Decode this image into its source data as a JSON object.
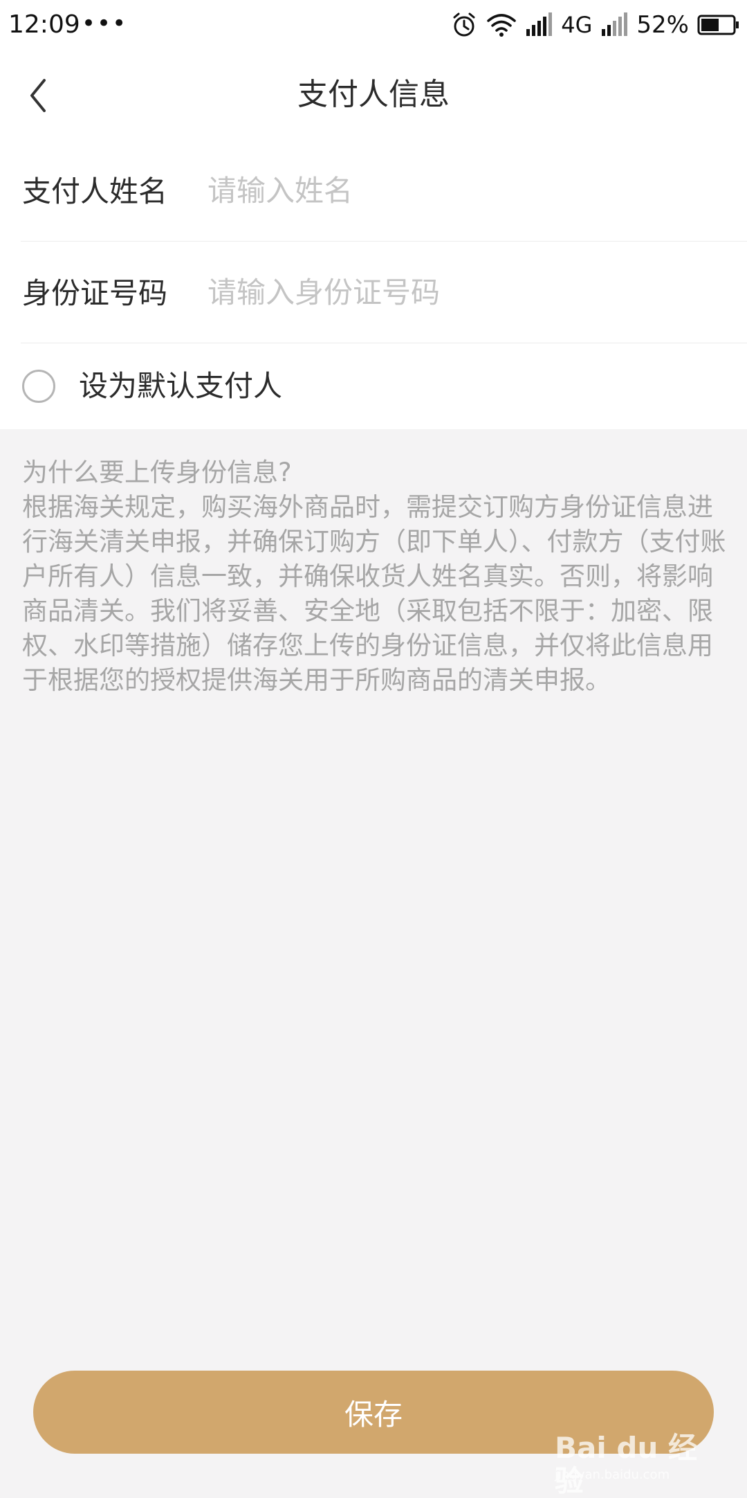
{
  "status_bar": {
    "time": "12:09",
    "more": "•••",
    "network": "4G",
    "battery": "52%",
    "icons": [
      "alarm-icon",
      "wifi-icon",
      "signal-icon",
      "signal-icon",
      "battery-icon"
    ]
  },
  "header": {
    "title": "支付人信息",
    "back_icon": "chevron-left-icon"
  },
  "form": {
    "name_label": "支付人姓名",
    "name_placeholder": "请输入姓名",
    "name_value": "",
    "id_label": "身份证号码",
    "id_placeholder": "请输入身份证号码",
    "id_value": "",
    "default_label": "设为默认支付人",
    "default_checked": false
  },
  "info": {
    "question": "为什么要上传身份信息?",
    "body": "根据海关规定，购买海外商品时，需提交订购方身份证信息进行海关清关申报，并确保订购方（即下单人）、付款方（支付账户所有人）信息一致，并确保收货人姓名真实。否则，将影响商品清关。我们将妥善、安全地（采取包括不限于：加密、限权、水印等措施）储存您上传的身份证信息，并仅将此信息用于根据您的授权提供海关用于所购商品的清关申报。"
  },
  "save_label": "保存",
  "watermark": {
    "text": "Bai du 经验",
    "sub": "jingyan.baidu.com"
  },
  "colors": {
    "accent": "#d1a76d",
    "background": "#f4f3f4",
    "placeholder": "#c4c4c4",
    "info_text": "#a6a6a6"
  }
}
